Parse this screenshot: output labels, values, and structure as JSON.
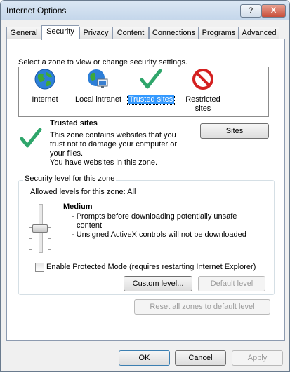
{
  "window": {
    "title": "Internet Options",
    "help_button": "?",
    "close_button": "X"
  },
  "tabs": [
    {
      "label": "General"
    },
    {
      "label": "Security"
    },
    {
      "label": "Privacy"
    },
    {
      "label": "Content"
    },
    {
      "label": "Connections"
    },
    {
      "label": "Programs"
    },
    {
      "label": "Advanced"
    }
  ],
  "zones": {
    "prompt": "Select a zone to view or change security settings.",
    "items": [
      {
        "label": "Internet",
        "icon": "globe-icon"
      },
      {
        "label": "Local intranet",
        "icon": "intranet-icon"
      },
      {
        "label": "Trusted sites",
        "icon": "checkmark-icon"
      },
      {
        "label_line1": "Restricted",
        "label_line2": "sites",
        "icon": "restricted-icon"
      }
    ],
    "selected": "Trusted sites"
  },
  "selected_zone": {
    "title": "Trusted sites",
    "description": [
      "This zone contains websites that you",
      "trust not to damage your computer or",
      "your files.",
      "You have websites in this zone."
    ],
    "sites_button": "Sites"
  },
  "security_level": {
    "group_title": "Security level for this zone",
    "allowed": "Allowed levels for this zone: All",
    "level_name": "Medium",
    "level_desc": [
      "- Prompts before downloading potentially unsafe",
      "content",
      "- Unsigned ActiveX controls will not be downloaded"
    ],
    "protected_mode_label": "Enable Protected Mode (requires restarting Internet Explorer)",
    "protected_mode_checked": false,
    "custom_level_button": "Custom level...",
    "default_level_button": "Default level"
  },
  "reset_button": "Reset all zones to default level",
  "footer": {
    "ok": "OK",
    "cancel": "Cancel",
    "apply": "Apply"
  },
  "colors": {
    "selection": "#3399ff",
    "checkmark": "#2fa66b",
    "restricted": "#d42020"
  }
}
